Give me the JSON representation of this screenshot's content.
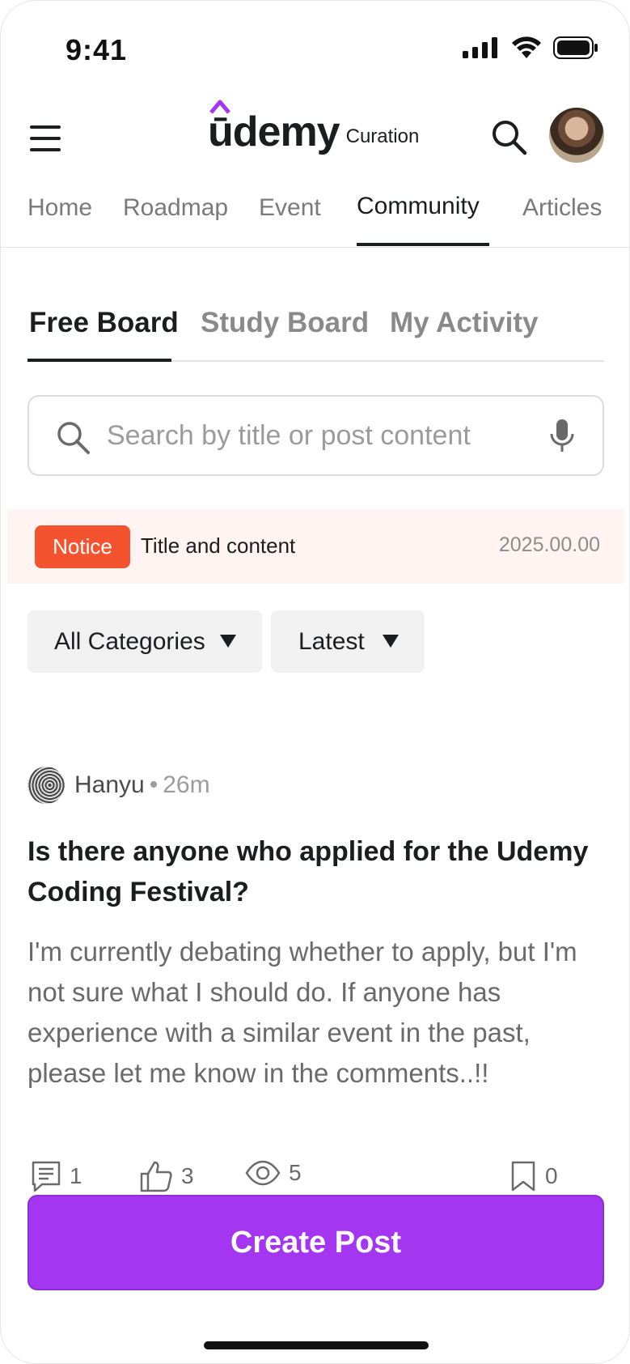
{
  "status_bar": {
    "time": "9:41"
  },
  "header": {
    "logo_text": "ūdemy",
    "logo_subtitle": "Curation"
  },
  "main_nav": {
    "tabs": [
      {
        "label": "Home",
        "active": false
      },
      {
        "label": "Roadmap",
        "active": false
      },
      {
        "label": "Event",
        "active": false
      },
      {
        "label": "Community",
        "active": true
      },
      {
        "label": "Articles",
        "active": false
      }
    ]
  },
  "sub_tabs": {
    "tabs": [
      {
        "label": "Free Board",
        "active": true
      },
      {
        "label": "Study Board",
        "active": false
      },
      {
        "label": "My Activity",
        "active": false
      }
    ]
  },
  "search": {
    "placeholder": "Search by title or post content",
    "value": ""
  },
  "notice": {
    "badge": "Notice",
    "title": "Title and content",
    "date": "2025.00.00"
  },
  "filters": {
    "category": "All Categories",
    "sort": "Latest"
  },
  "post": {
    "author": "Hanyu",
    "separator": "•",
    "time": "26m",
    "title": "Is there anyone who applied for the Udemy Coding Festival?",
    "body": "I'm currently debating whether to apply, but I'm not sure what I should do. If anyone has experience with a similar event in the past, please let me know in the comments..!!",
    "stats": {
      "comments": "1",
      "likes": "3",
      "views": "5",
      "bookmarks": "0"
    }
  },
  "create_button": {
    "label": "Create Post"
  },
  "colors": {
    "accent": "#a435f0",
    "notice": "#f4532f",
    "notice_bg": "#fff4f1"
  }
}
